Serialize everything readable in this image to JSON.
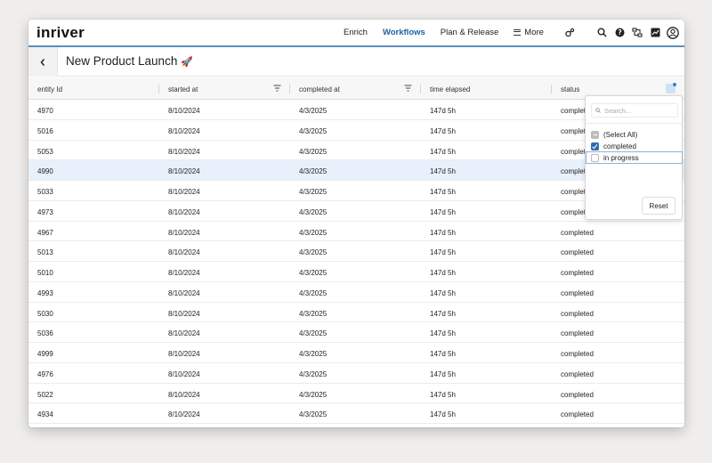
{
  "app": {
    "logo": "inriver"
  },
  "nav": {
    "links": [
      {
        "label": "Enrich",
        "active": false
      },
      {
        "label": "Workflows",
        "active": true
      },
      {
        "label": "Plan & Release",
        "active": false
      }
    ],
    "more_label": "More",
    "icons": [
      "settings-link-icon",
      "search-icon",
      "help-icon",
      "connect-icon",
      "chart-icon",
      "user-avatar-icon"
    ]
  },
  "page": {
    "title": "New Product Launch",
    "title_emoji": "🚀"
  },
  "grid": {
    "columns": [
      "entity Id",
      "started at",
      "completed at",
      "time elapsed",
      "status"
    ],
    "rows": [
      {
        "entity_id": "4970",
        "started_at": "8/10/2024",
        "completed_at": "4/3/2025",
        "time_elapsed": "147d 5h",
        "status": "completed"
      },
      {
        "entity_id": "5016",
        "started_at": "8/10/2024",
        "completed_at": "4/3/2025",
        "time_elapsed": "147d 5h",
        "status": "completed"
      },
      {
        "entity_id": "5053",
        "started_at": "8/10/2024",
        "completed_at": "4/3/2025",
        "time_elapsed": "147d 5h",
        "status": "completed"
      },
      {
        "entity_id": "4990",
        "started_at": "8/10/2024",
        "completed_at": "4/3/2025",
        "time_elapsed": "147d 5h",
        "status": "completed"
      },
      {
        "entity_id": "5033",
        "started_at": "8/10/2024",
        "completed_at": "4/3/2025",
        "time_elapsed": "147d 5h",
        "status": "completed"
      },
      {
        "entity_id": "4973",
        "started_at": "8/10/2024",
        "completed_at": "4/3/2025",
        "time_elapsed": "147d 5h",
        "status": "completed"
      },
      {
        "entity_id": "4967",
        "started_at": "8/10/2024",
        "completed_at": "4/3/2025",
        "time_elapsed": "147d 5h",
        "status": "completed"
      },
      {
        "entity_id": "5013",
        "started_at": "8/10/2024",
        "completed_at": "4/3/2025",
        "time_elapsed": "147d 5h",
        "status": "completed"
      },
      {
        "entity_id": "5010",
        "started_at": "8/10/2024",
        "completed_at": "4/3/2025",
        "time_elapsed": "147d 5h",
        "status": "completed"
      },
      {
        "entity_id": "4993",
        "started_at": "8/10/2024",
        "completed_at": "4/3/2025",
        "time_elapsed": "147d 5h",
        "status": "completed"
      },
      {
        "entity_id": "5030",
        "started_at": "8/10/2024",
        "completed_at": "4/3/2025",
        "time_elapsed": "147d 5h",
        "status": "completed"
      },
      {
        "entity_id": "5036",
        "started_at": "8/10/2024",
        "completed_at": "4/3/2025",
        "time_elapsed": "147d 5h",
        "status": "completed"
      },
      {
        "entity_id": "4999",
        "started_at": "8/10/2024",
        "completed_at": "4/3/2025",
        "time_elapsed": "147d 5h",
        "status": "completed"
      },
      {
        "entity_id": "4976",
        "started_at": "8/10/2024",
        "completed_at": "4/3/2025",
        "time_elapsed": "147d 5h",
        "status": "completed"
      },
      {
        "entity_id": "5022",
        "started_at": "8/10/2024",
        "completed_at": "4/3/2025",
        "time_elapsed": "147d 5h",
        "status": "completed"
      },
      {
        "entity_id": "4934",
        "started_at": "8/10/2024",
        "completed_at": "4/3/2025",
        "time_elapsed": "147d 5h",
        "status": "completed"
      }
    ]
  },
  "filter_popup": {
    "search_placeholder": "Search...",
    "options": [
      {
        "label": "(Select All)",
        "state": "indeterminate"
      },
      {
        "label": "completed",
        "state": "checked"
      },
      {
        "label": "in progress",
        "state": "unchecked"
      }
    ],
    "reset_label": "Reset"
  },
  "colors": {
    "accent": "#1f5fa5",
    "nav_underline": "#5b8fbd",
    "checkbox_checked": "#2f6db3",
    "row_highlight": "#e8f1fb"
  }
}
